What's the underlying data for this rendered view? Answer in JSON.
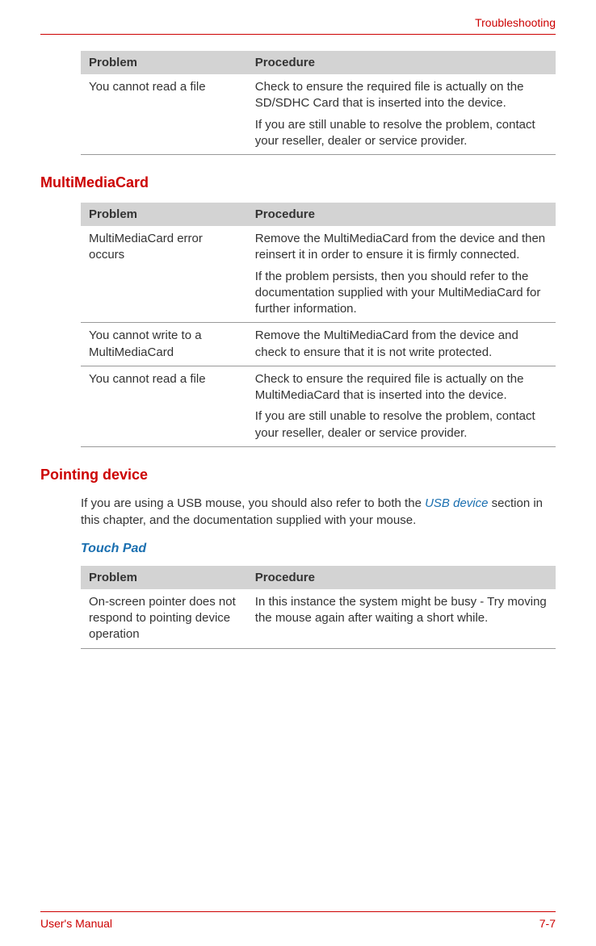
{
  "header": {
    "section": "Troubleshooting"
  },
  "table1": {
    "headers": {
      "problem": "Problem",
      "procedure": "Procedure"
    },
    "rows": [
      {
        "problem": "You cannot read a file",
        "procedure_p1": "Check to ensure the required file is actually on the SD/SDHC Card that is inserted into the device.",
        "procedure_p2": "If you are still unable to resolve the problem, contact your reseller, dealer or service provider."
      }
    ]
  },
  "section_mmc": {
    "heading": "MultiMediaCard",
    "headers": {
      "problem": "Problem",
      "procedure": "Procedure"
    },
    "rows": [
      {
        "problem": "MultiMediaCard error occurs",
        "procedure_p1": "Remove the MultiMediaCard from the device and then reinsert it in order to ensure it is firmly connected.",
        "procedure_p2": "If the problem persists, then you should refer to the documentation supplied with your MultiMediaCard for further information."
      },
      {
        "problem": "You cannot write to a MultiMediaCard",
        "procedure_p1": "Remove the MultiMediaCard from the device and check to ensure that it is not write protected."
      },
      {
        "problem": "You cannot read a file",
        "procedure_p1": "Check to ensure the required file is actually on the MultiMediaCard that is inserted into the device.",
        "procedure_p2": "If you are still unable to resolve the problem, contact your reseller, dealer or service provider."
      }
    ]
  },
  "section_pointing": {
    "heading": "Pointing device",
    "intro_before_link": "If you are using a USB mouse, you should also refer to both the ",
    "intro_link": "USB device",
    "intro_after_link": " section in this chapter, and the documentation supplied with your mouse.",
    "sub_heading": "Touch Pad",
    "headers": {
      "problem": "Problem",
      "procedure": "Procedure"
    },
    "rows": [
      {
        "problem": "On-screen pointer does not respond to pointing device operation",
        "procedure_p1": "In this instance the system might be busy - Try moving the mouse again after waiting a short while."
      }
    ]
  },
  "footer": {
    "left": "User's Manual",
    "right": "7-7"
  }
}
